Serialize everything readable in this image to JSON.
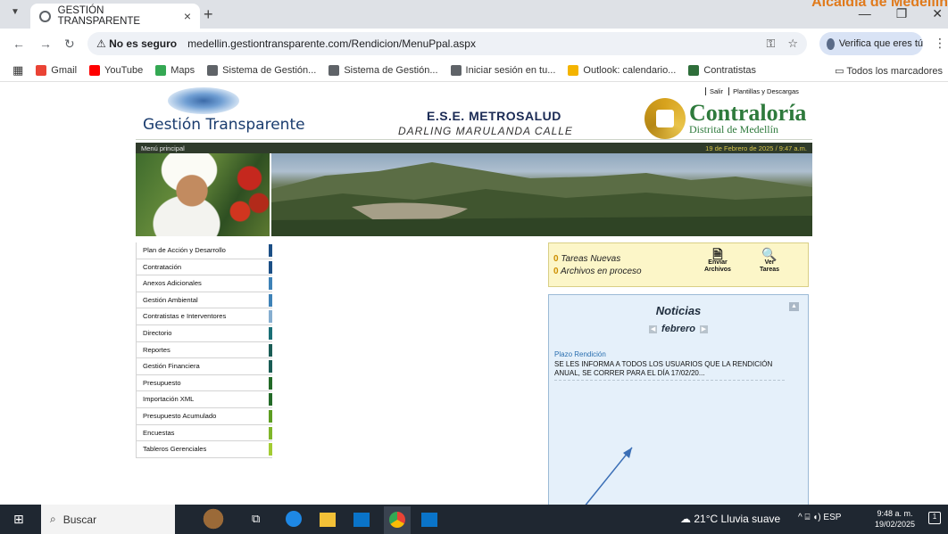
{
  "browser": {
    "tab_title": "GESTIÓN TRANSPARENTE",
    "tab_close": "×",
    "new_tab": "+",
    "top_right_text": "Alcaldía de Medellín",
    "security_label": "No es seguro",
    "url": "medellin.gestiontransparente.com/Rendicion/MenuPpal.aspx",
    "verify_label": "Verifica que eres tú",
    "bookmarks": [
      {
        "label": "Gmail",
        "color": "#ea4335"
      },
      {
        "label": "YouTube",
        "color": "#ff0000"
      },
      {
        "label": "Maps",
        "color": "#34a853"
      },
      {
        "label": "Sistema de Gestión...",
        "color": "#5f6368"
      },
      {
        "label": "Sistema de Gestión...",
        "color": "#5f6368"
      },
      {
        "label": "Iniciar sesión en tu...",
        "color": "#5f6368"
      },
      {
        "label": "Outlook: calendario...",
        "color": "#f4b400"
      },
      {
        "label": "Contratistas",
        "color": "#2e6e3a"
      }
    ],
    "all_bookmarks": "Todos los marcadores"
  },
  "header": {
    "logo_text_1": "Gestión Tra",
    "logo_text_2": "nsparente",
    "entity": "E.S.E. METROSALUD",
    "person": "DARLING MARULANDA CALLE",
    "contraloria_title": "Contraloría",
    "contraloria_subtitle": "Distrital de Medellín",
    "link_salir": "Salir",
    "link_plantillas": "Plantillas y Descargas",
    "menu_principal": "Menú principal",
    "datetime": "19 de Febrero de 2025 / 9:47 a.m."
  },
  "menu": [
    {
      "label": "Plan de Acción y Desarrollo",
      "color": "#1c4f86"
    },
    {
      "label": "Contratación",
      "color": "#1c4f86"
    },
    {
      "label": "Anexos Adicionales",
      "color": "#3e82b7"
    },
    {
      "label": "Gestión Ambiental",
      "color": "#3e82b7"
    },
    {
      "label": "Contratistas e Interventores",
      "color": "#86aed0"
    },
    {
      "label": "Directorio",
      "color": "#1a6f76"
    },
    {
      "label": "Reportes",
      "color": "#1a5c55"
    },
    {
      "label": "Gestión Financiera",
      "color": "#1a5c55"
    },
    {
      "label": "Presupuesto",
      "color": "#236a28"
    },
    {
      "label": "Importación XML",
      "color": "#236a28"
    },
    {
      "label": "Presupuesto Acumulado",
      "color": "#5c9d22"
    },
    {
      "label": "Encuestas",
      "color": "#7fb62a"
    },
    {
      "label": "Tableros Gerenciales",
      "color": "#a3cc33"
    }
  ],
  "tasks": {
    "new_count": "0",
    "new_label": "Tareas Nuevas",
    "process_count": "0",
    "process_label": "Archivos en proceso",
    "send_label_1": "Enviar",
    "send_label_2": "Archivos",
    "view_label_1": "Ver",
    "view_label_2": "Tareas"
  },
  "news": {
    "title": "Noticias",
    "month": "febrero",
    "item_title": "Plazo Rendición",
    "item_body": "SE LES INFORMA A TODOS LOS USUARIOS QUE LA RENDICIÓN ANUAL, SE CORRER PARA EL DÍA 17/02/20..."
  },
  "taskbar": {
    "search_label": "Buscar",
    "weather": "21°C Lluvia suave",
    "language": "ESP",
    "time": "9:48 a. m.",
    "date": "19/02/2025",
    "notification_count": "1"
  }
}
